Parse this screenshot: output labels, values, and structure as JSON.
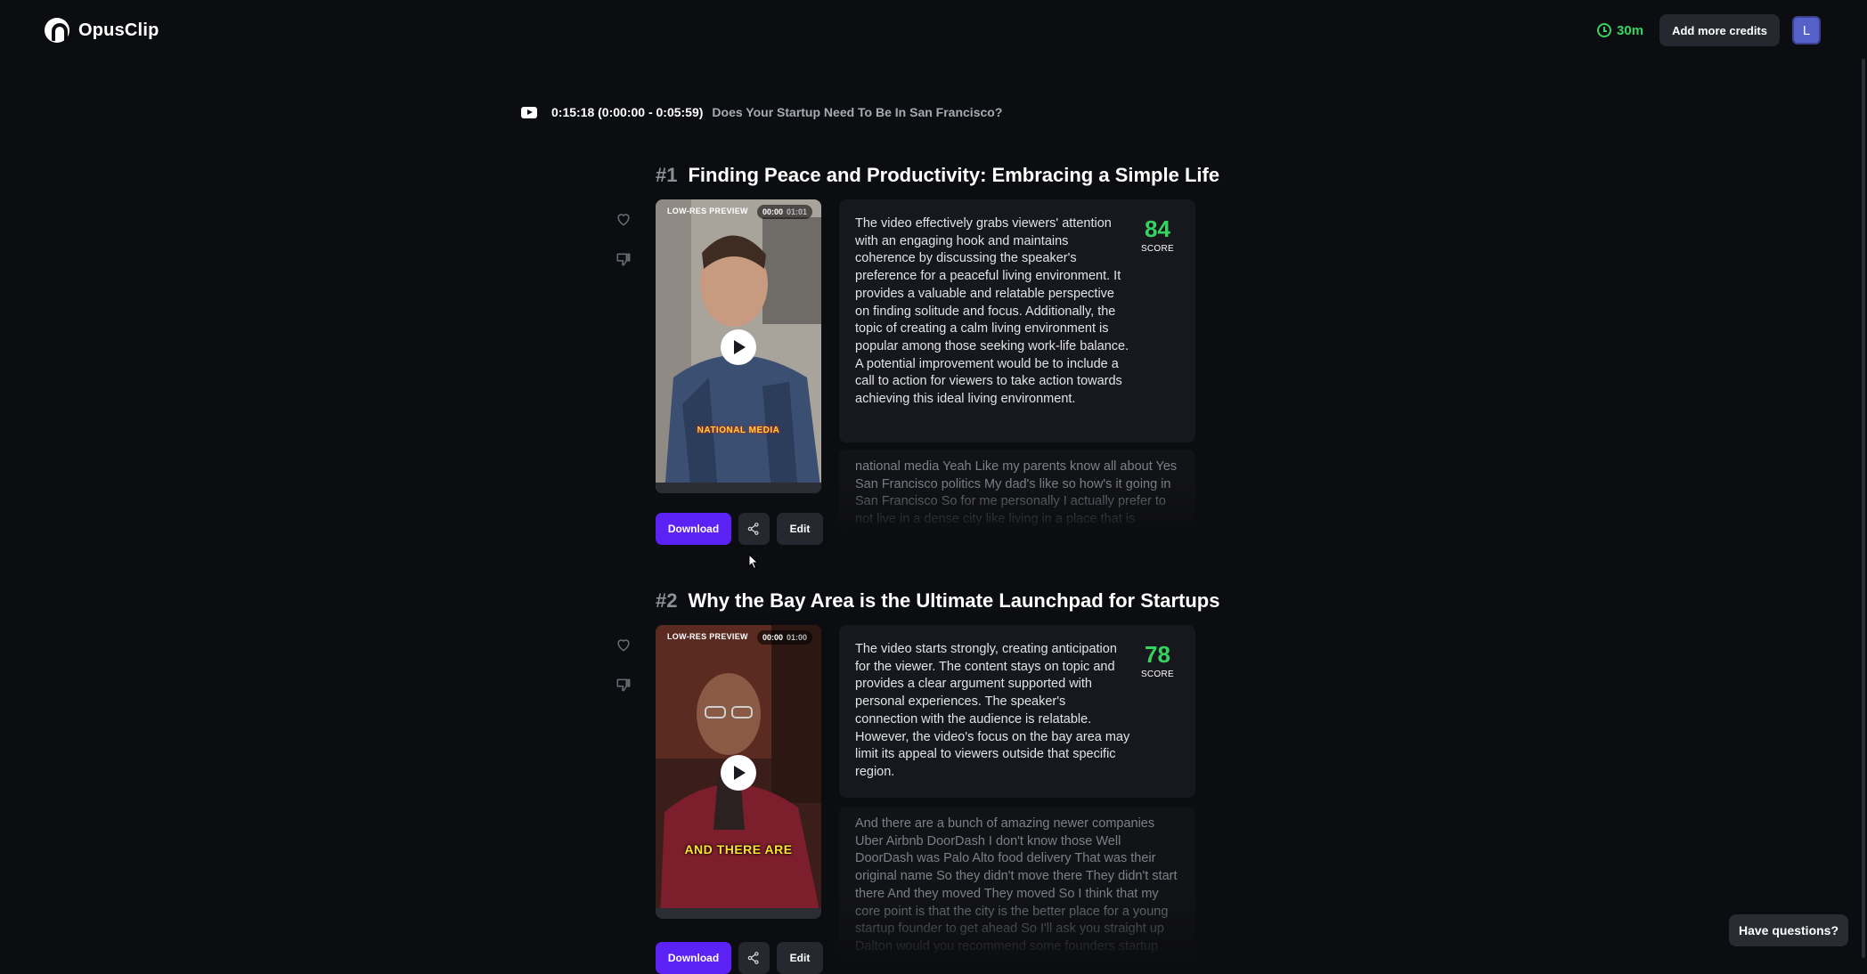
{
  "app": {
    "name": "OpusClip"
  },
  "header": {
    "credits": "30m",
    "add_credits_label": "Add more credits",
    "avatar_initial": "L"
  },
  "source": {
    "time": "0:15:18 (0:00:00 - 0:05:59)",
    "title": "Does Your Startup Need To Be In San Francisco?"
  },
  "clips": [
    {
      "number": "#1",
      "title": "Finding Peace and Productivity: Embracing a Simple Life",
      "preview_label": "LOW-RES PREVIEW",
      "time_current": "00:00",
      "time_total": "01:01",
      "caption": "NATIONAL MEDIA",
      "analysis": "The video effectively grabs viewers' attention with an engaging hook and maintains coherence by discussing the speaker's preference for a peaceful living environment. It provides a valuable and relatable perspective on finding solitude and focus. Additionally, the topic of creating a calm living environment is popular among those seeking work-life balance. A potential improvement would be to include a call to action for viewers to take action towards achieving this ideal living environment.",
      "score": "84",
      "score_label": "SCORE",
      "transcript": "national media Yeah Like my parents know all about Yes San Francisco politics My dad's like so how's it going in San Francisco So for me personally I actually prefer to not live in a dense city like living in a place that is",
      "download_label": "Download",
      "edit_label": "Edit"
    },
    {
      "number": "#2",
      "title": "Why the Bay Area is the Ultimate Launchpad for Startups",
      "preview_label": "LOW-RES PREVIEW",
      "time_current": "00:00",
      "time_total": "01:00",
      "caption": "AND THERE ARE",
      "analysis": "The video starts strongly, creating anticipation for the viewer. The content stays on topic and provides a clear argument supported with personal experiences. The speaker's connection with the audience is relatable. However, the video's focus on the bay area may limit its appeal to viewers outside that specific region.",
      "score": "78",
      "score_label": "SCORE",
      "transcript": "And there are a bunch of amazing newer companies Uber Airbnb DoorDash I don't know those Well DoorDash was Palo Alto food delivery That was their original name So they didn't move there They didn't start there And they moved They moved So I think that my core point is that the city is the better place for a young startup founder to get ahead So I'll ask you straight up Dalton would you recommend some founders startup",
      "download_label": "Download",
      "edit_label": "Edit"
    }
  ],
  "help_label": "Have questions?",
  "colors": {
    "accent": "#5b21f5",
    "score": "#37d35f",
    "background": "#0c0d10"
  }
}
